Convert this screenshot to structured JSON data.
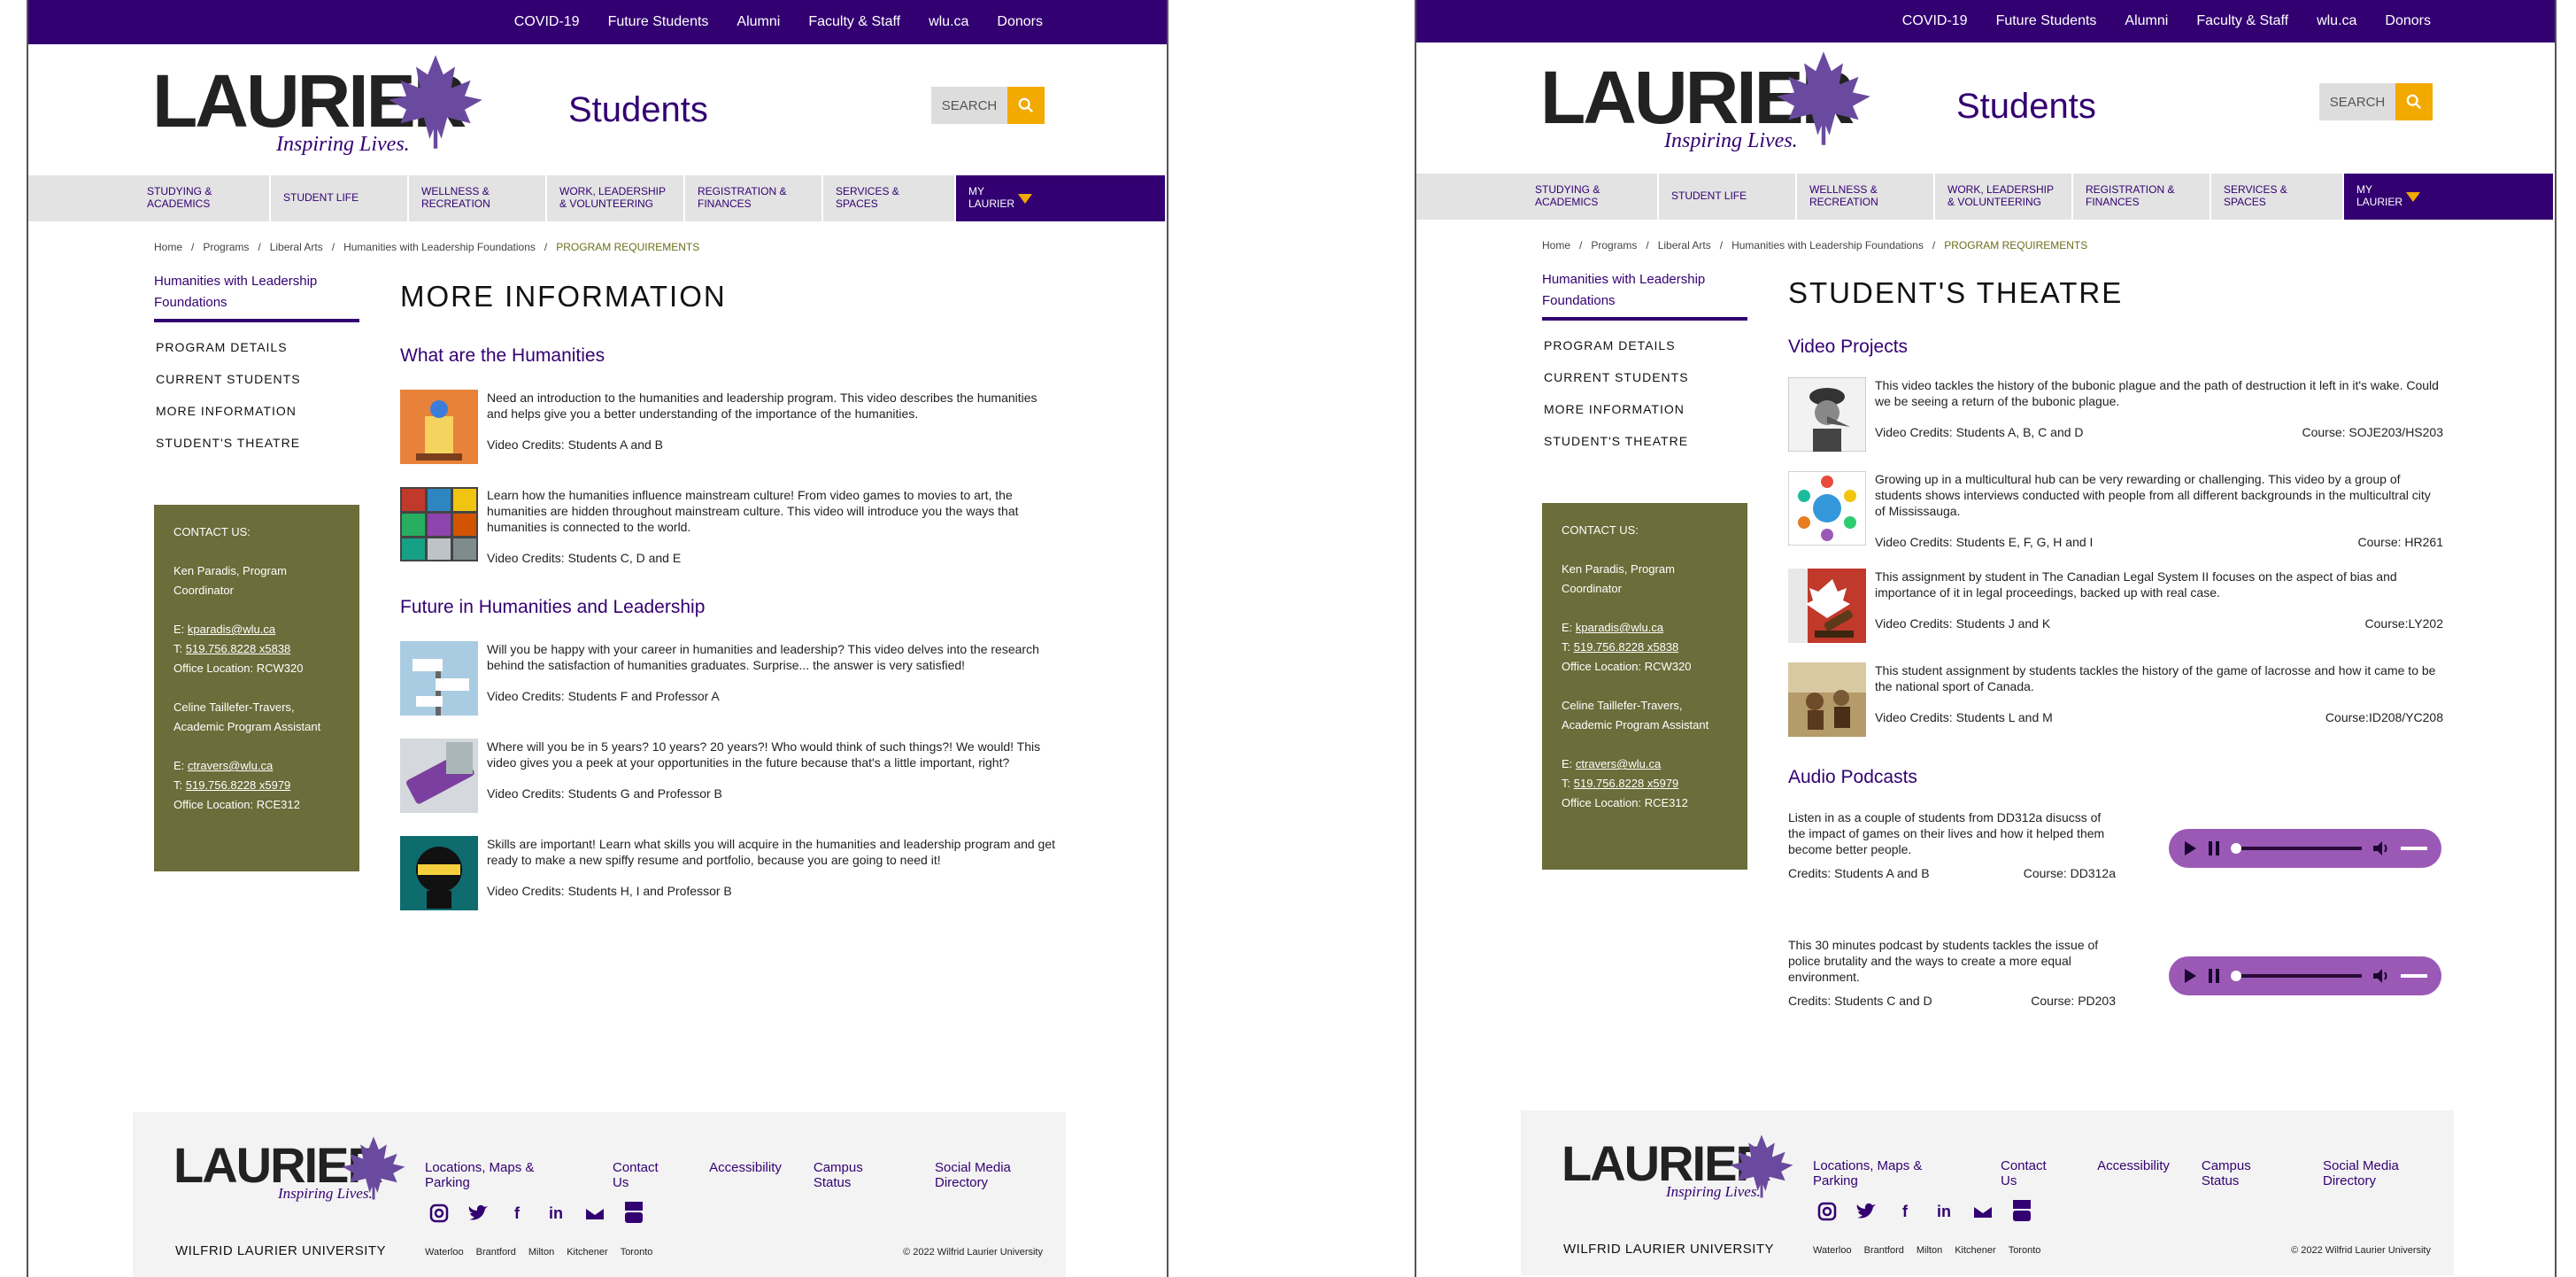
{
  "colors": {
    "brand_purple": "#330072",
    "gold": "#f2a900",
    "contact_olive": "#6b6d3a",
    "player_purple": "#9b59b6"
  },
  "top_links": [
    "COVID-19",
    "Future Students",
    "Alumni",
    "Faculty & Staff",
    "wlu.ca",
    "Donors"
  ],
  "logo": {
    "word": "LAURIER",
    "tagline": "Inspiring Lives."
  },
  "site_title": "Students",
  "search_label": "SEARCH",
  "nav": [
    "STUDYING & ACADEMICS",
    "STUDENT LIFE",
    "WELLNESS & RECREATION",
    "WORK, LEADERSHIP & VOLUNTEERING",
    "REGISTRATION & FINANCES",
    "SERVICES & SPACES",
    "MY LAURIER"
  ],
  "breadcrumbs": [
    "Home",
    "Programs",
    "Liberal Arts",
    "Humanities with Leadership Foundations",
    "PROGRAM REQUIREMENTS"
  ],
  "sidenav": {
    "head": "Humanities with Leadership Foundations",
    "links": [
      "PROGRAM DETAILS",
      "CURRENT STUDENTS",
      "MORE INFORMATION",
      "STUDENT'S THEATRE"
    ]
  },
  "contact": {
    "title": "CONTACT US:",
    "person1": "Ken Paradis, Program Coordinator",
    "email1": "kparadis@wlu.ca",
    "phone1": "519.756.8228 x5838",
    "office1": "Office Location: RCW320",
    "person2": "Celine Taillefer-Travers, Academic Program Assistant",
    "email2": "ctravers@wlu.ca",
    "phone2": "519.756.8228 x5979",
    "office2": "Office Location: RCE312",
    "email_prefix": "E: ",
    "phone_prefix": "T: "
  },
  "left": {
    "title": "MORE INFORMATION",
    "section1": "What are the Humanities",
    "section2": "Future in Humanities and Leadership",
    "entries1": [
      {
        "text": "Need an introduction to the humanities and leadership program. This video describes the humanities and helps give you a better understanding of the importance of the humanities.",
        "credits": "Video Credits: Students A and B"
      },
      {
        "text": "Learn how the humanities influence mainstream culture! From video games to movies to art, the humanities are hidden throughout mainstream culture. This video will introduce you the ways that humanities is connected to the world.",
        "credits": "Video Credits: Students C, D and E"
      }
    ],
    "entries2": [
      {
        "text": "Will you be happy with your career in humanities and leadership? This video delves into the research behind the satisfaction of humanities graduates. Surprise... the answer is very satisfied!",
        "credits": "Video Credits: Students F and Professor A"
      },
      {
        "text": "Where will you be in 5 years? 10 years? 20 years?! Who would think of such things?! We would! This video gives you a peek at your opportunities in the future because that's a little important, right?",
        "credits": "Video Credits: Students G and Professor B"
      },
      {
        "text": "Skills are important! Learn what skills you will acquire in the humanities and leadership program and get ready to make a new spiffy resume and portfolio, because you are going to need it!",
        "credits": "Video Credits: Students H, I and Professor B"
      }
    ]
  },
  "right": {
    "title": "STUDENT'S THEATRE",
    "section1": "Video Projects",
    "section2": "Audio Podcasts",
    "videos": [
      {
        "text": "This video tackles the history of the bubonic plague and the path of destruction it left in it's wake. Could we be seeing a return of the bubonic plague.",
        "credits": "Video Credits: Students A, B, C and D",
        "course": "Course: SOJE203/HS203"
      },
      {
        "text": "Growing up in a multicultural hub can be very rewarding or challenging. This video by a group of students shows interviews conducted with people from all different backgrounds in the multicultral city of Mississauga.",
        "credits": "Video Credits: Students E, F, G, H and I",
        "course": "Course: HR261"
      },
      {
        "text": "This assignment by student in The Canadian Legal System II focuses on the aspect of bias and importance of it in legal proceedings, backed up with real case.",
        "credits": "Video Credits: Students J and K",
        "course": "Course:LY202"
      },
      {
        "text": "This student assignment by students tackles the history of the game of lacrosse and how it came to be the national sport of Canada.",
        "credits": "Video Credits: Students L and M",
        "course": "Course:ID208/YC208"
      }
    ],
    "podcasts": [
      {
        "text": "Listen in as a couple of students from DD312a disucss of the impact of games on their lives and how it helped them become better people.",
        "credits": "Credits: Students A and B",
        "course": "Course: DD312a"
      },
      {
        "text": "This 30 minutes podcast by students tackles the issue of police brutality and the ways to create a more equal environment.",
        "credits": "Credits: Students C and D",
        "course": "Course: PD203"
      }
    ]
  },
  "footer": {
    "links": [
      "Locations, Maps & Parking",
      "Contact Us",
      "Accessibility",
      "Campus Status",
      "Social Media Directory"
    ],
    "social_icons": [
      "instagram-icon",
      "twitter-icon",
      "facebook-icon",
      "linkedin-icon",
      "flickr-icon",
      "youtube-icon"
    ],
    "university": "WILFRID LAURIER UNIVERSITY",
    "campuses": [
      "Waterloo",
      "Brantford",
      "Milton",
      "Kitchener",
      "Toronto"
    ],
    "copyright": "© 2022 Wilfrid Laurier University"
  }
}
